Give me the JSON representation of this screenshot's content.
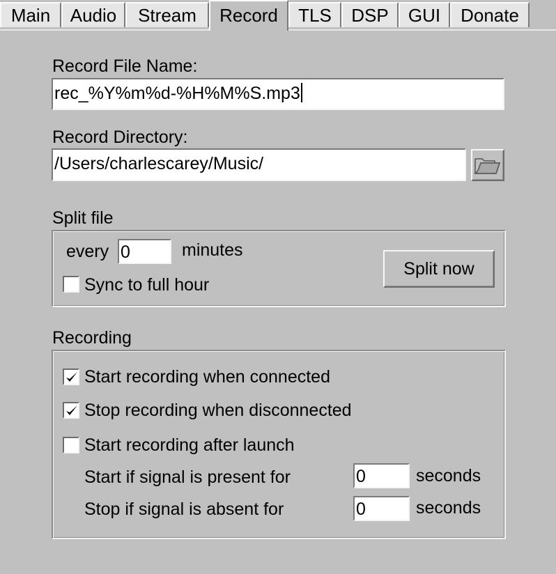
{
  "tabs": [
    {
      "label": "Main"
    },
    {
      "label": "Audio"
    },
    {
      "label": "Stream"
    },
    {
      "label": "Record",
      "active": true
    },
    {
      "label": "TLS"
    },
    {
      "label": "DSP"
    },
    {
      "label": "GUI"
    },
    {
      "label": "Donate"
    }
  ],
  "record_file": {
    "label": "Record File Name:",
    "value": "rec_%Y%m%d-%H%M%S.mp3"
  },
  "record_dir": {
    "label": "Record Directory:",
    "value": "/Users/charlescarey/Music/",
    "browse_icon": "folder-icon"
  },
  "split": {
    "title": "Split file",
    "every_label": "every",
    "minutes_value": "0",
    "minutes_label": "minutes",
    "sync_label": "Sync to full hour",
    "sync_checked": false,
    "split_now_label": "Split now"
  },
  "recording": {
    "title": "Recording",
    "start_connected_label": "Start recording when connected",
    "start_connected_checked": true,
    "stop_disconnected_label": "Stop recording when disconnected",
    "stop_disconnected_checked": true,
    "start_launch_label": "Start recording after launch",
    "start_launch_checked": false,
    "signal_present_label": "Start if signal is present for",
    "signal_present_value": "0",
    "signal_present_unit": "seconds",
    "signal_absent_label": "Stop if signal is absent for",
    "signal_absent_value": "0",
    "signal_absent_unit": "seconds"
  }
}
